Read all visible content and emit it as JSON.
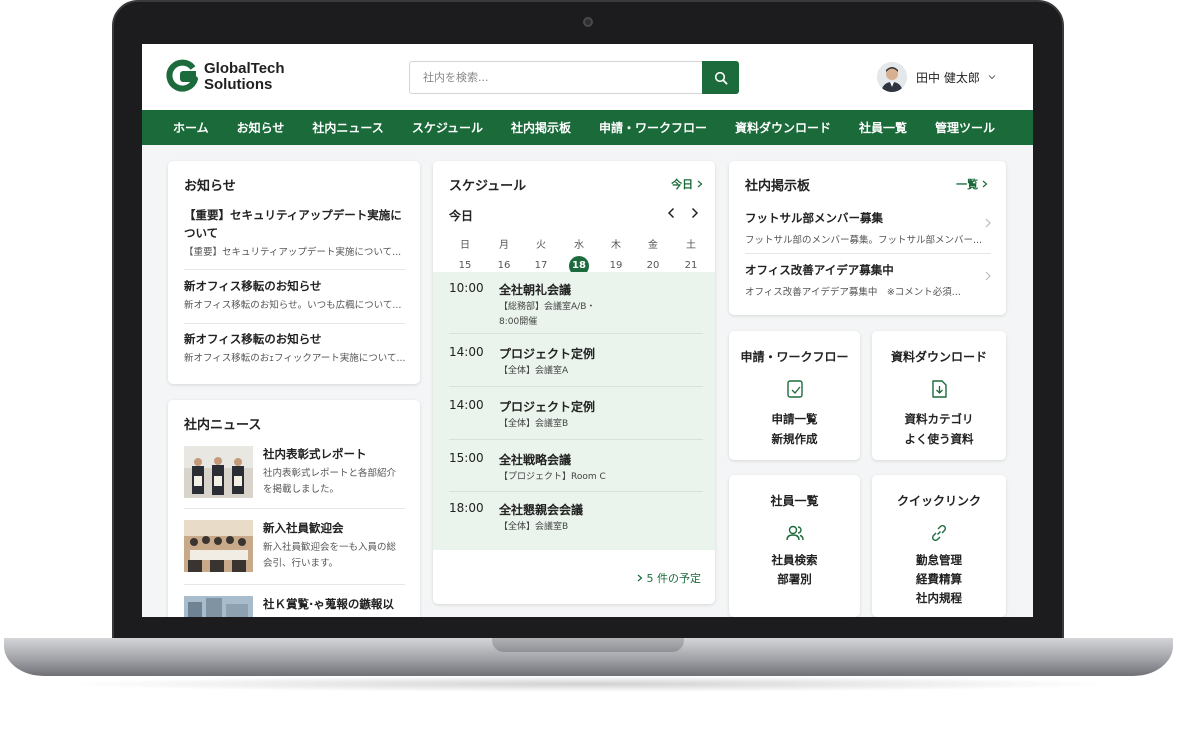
{
  "header": {
    "logo_line1": "GlobalTech",
    "logo_line2": "Solutions",
    "search_placeholder": "社内を検索...",
    "user_name": "田中 健太郎"
  },
  "nav": [
    "ホーム",
    "お知らせ",
    "社内ニュース",
    "スケジュール",
    "社内掲示板",
    "申請・ワークフロー",
    "資料ダウンロード",
    "社員一覧",
    "管理ツール"
  ],
  "notices": {
    "title": "お知らせ",
    "items": [
      {
        "title": "【重要】セキュリティアップデート実施について",
        "summary": "【重要】セキュリティアップデート実施について..."
      },
      {
        "title": "新オフィス移転のお知らせ",
        "summary": "新オフィス移転のお知らせ。いつも広楓について..."
      },
      {
        "title": "新オフィス移転のお知らせ",
        "summary": "新オフィス移転のおｪフィックアート実施について..."
      }
    ]
  },
  "news": {
    "title": "社内ニュース",
    "items": [
      {
        "title": "社内表彰式レポート",
        "desc": "社内表彰式レポートと各部紹介を掲載しました。"
      },
      {
        "title": "新入社員歓迎会",
        "desc": "新入社員歓迎会を一も入員の総会引、行います。"
      },
      {
        "title": "社Ｋ賞覧·ゃ蒐報の鏃報以",
        "desc": ""
      }
    ]
  },
  "schedule": {
    "title": "スケジュール",
    "today_link": "今日",
    "cal_label": "今日",
    "weekdays": [
      "日",
      "月",
      "火",
      "水",
      "木",
      "金",
      "土"
    ],
    "days": [
      "15",
      "16",
      "17",
      "18",
      "19",
      "20",
      "21"
    ],
    "today_index": 3,
    "events": [
      {
        "time": "10:00",
        "name": "全社朝礼会議",
        "loc": "【総務部】会議室A/B・8:00開催"
      },
      {
        "time": "14:00",
        "name": "プロジェクト定例",
        "loc": "【全体】会議室A"
      },
      {
        "time": "14:00",
        "name": "プロジェクト定例",
        "loc": "【全体】会議室B"
      },
      {
        "time": "15:00",
        "name": "全社戦略会議",
        "loc": "【プロジェクト】Room C"
      },
      {
        "time": "18:00",
        "name": "全社懇親会会議",
        "loc": "【全体】会議室B"
      }
    ],
    "more_link": "5 件の予定"
  },
  "board": {
    "title": "社内掲示板",
    "list_link": "一覧",
    "items": [
      {
        "title": "フットサル部メンバー募集",
        "summary": "フットサル部のメンバー募集。フットサル部メンバー..."
      },
      {
        "title": "オフィス改善アイデア募集中",
        "summary": "オフィス改善アイデデア募集中　※コメント必須..."
      }
    ]
  },
  "tiles": {
    "workflow": {
      "title": "申請・ワークフロー",
      "links": [
        "申請一覧",
        "新規作成"
      ],
      "icon": "tablet-icon"
    },
    "downloads": {
      "title": "資料ダウンロード",
      "links": [
        "資料カテゴリ",
        "よく使う資料"
      ],
      "icon": "download-icon"
    },
    "employees": {
      "title": "社員一覧",
      "links": [
        "社員検索",
        "部署別"
      ],
      "icon": "users-icon"
    },
    "quicklinks": {
      "title": "クイックリンク",
      "links": [
        "勤怠管理",
        "経費精算",
        "社内規程"
      ],
      "icon": "link-icon"
    }
  },
  "colors": {
    "brand": "#1a6a3a",
    "today": "#1c6b3c",
    "event_bg": "#eaf3ec"
  }
}
